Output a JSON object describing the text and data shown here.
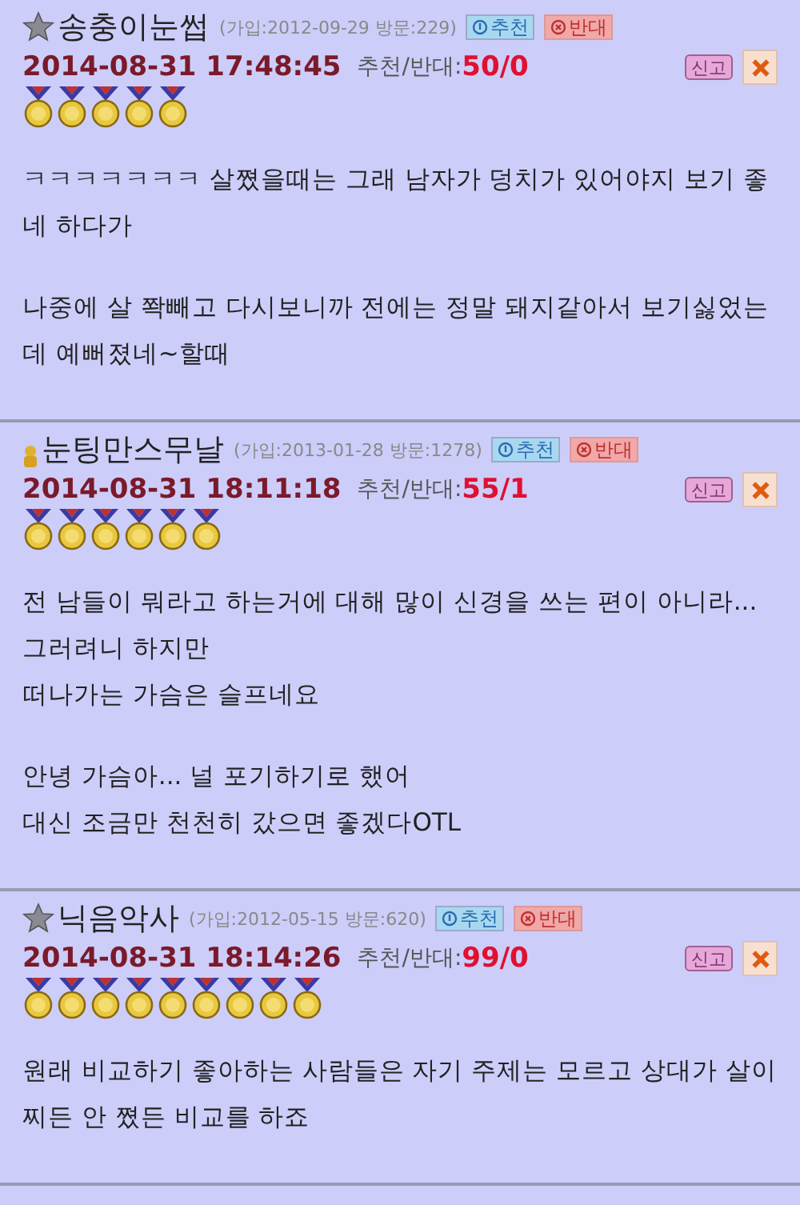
{
  "comments": [
    {
      "kind": "star",
      "nickname": "송충이눈썹",
      "member_info": "(가입:2012-09-29 방문:229)",
      "recommend": "추천",
      "oppose": "반대",
      "datetime": "2014-08-31 17:48:45",
      "votes_label": "추천/반대:",
      "votes": "50/0",
      "report": "신고",
      "stars": 5,
      "paragraphs": [
        "ㅋㅋㅋㅋㅋㅋㅋ 살쪘을때는 그래 남자가 덩치가 있어야지 보기 좋네 하다가",
        "나중에 살 쫙빼고 다시보니까 전에는 정말 돼지같아서 보기싫었는데 예뻐졌네~할때"
      ]
    },
    {
      "kind": "figure",
      "nickname": "눈팅만스무날",
      "member_info": "(가입:2013-01-28 방문:1278)",
      "recommend": "추천",
      "oppose": "반대",
      "datetime": "2014-08-31 18:11:18",
      "votes_label": "추천/반대:",
      "votes": "55/1",
      "report": "신고",
      "stars": 6,
      "paragraphs": [
        "전 남들이 뭐라고 하는거에 대해 많이 신경을 쓰는 편이 아니라... 그러려니 하지만\n떠나가는 가슴은 슬프네요",
        "안녕 가슴아... 널 포기하기로 했어\n대신 조금만 천천히 갔으면 좋겠다OTL"
      ]
    },
    {
      "kind": "star",
      "nickname": "닉음악사",
      "member_info": "(가입:2012-05-15 방문:620)",
      "recommend": "추천",
      "oppose": "반대",
      "datetime": "2014-08-31 18:14:26",
      "votes_label": "추천/반대:",
      "votes": "99/0",
      "report": "신고",
      "stars": 9,
      "paragraphs": [
        "원래 비교하기 좋아하는 사람들은 자기 주제는 모르고 상대가 살이 찌든 안 쪘든 비교를 하죠"
      ]
    }
  ]
}
